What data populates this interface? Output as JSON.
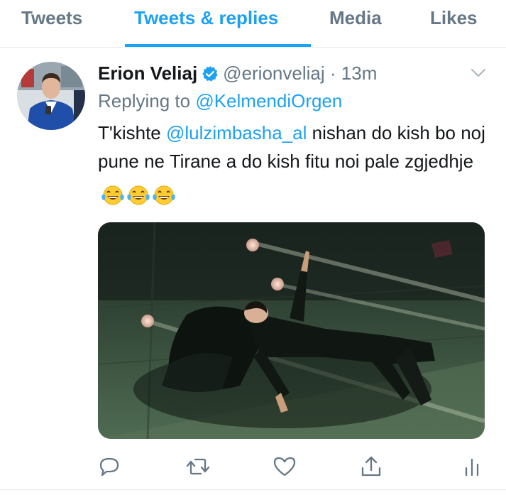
{
  "tabs": [
    {
      "label": "Tweets",
      "active": false
    },
    {
      "label": "Tweets & replies",
      "active": true
    },
    {
      "label": "Media",
      "active": false
    },
    {
      "label": "Likes",
      "active": false
    }
  ],
  "tweet": {
    "author_name": "Erion Veliaj",
    "verified": true,
    "handle": "@erionveliaj",
    "separator": "·",
    "time": "13m",
    "reply_prefix": "Replying to",
    "reply_handle": "@KelmendiOrgen",
    "text_before": "T'kishte",
    "mention": "@lulzimbasha_al",
    "text_after": "nishan do kish bo noj pune ne Tirane a do kish fitu noi pale zgjedhje",
    "emojis": [
      "face-with-tears-of-joy",
      "face-with-tears-of-joy",
      "face-with-tears-of-joy"
    ],
    "actions": [
      "reply-icon",
      "retweet-icon",
      "like-icon",
      "share-icon",
      "analytics-icon"
    ]
  },
  "colors": {
    "accent": "#1da1f2",
    "text": "#14171a",
    "secondary": "#657786",
    "divider": "#e1e8ed"
  }
}
